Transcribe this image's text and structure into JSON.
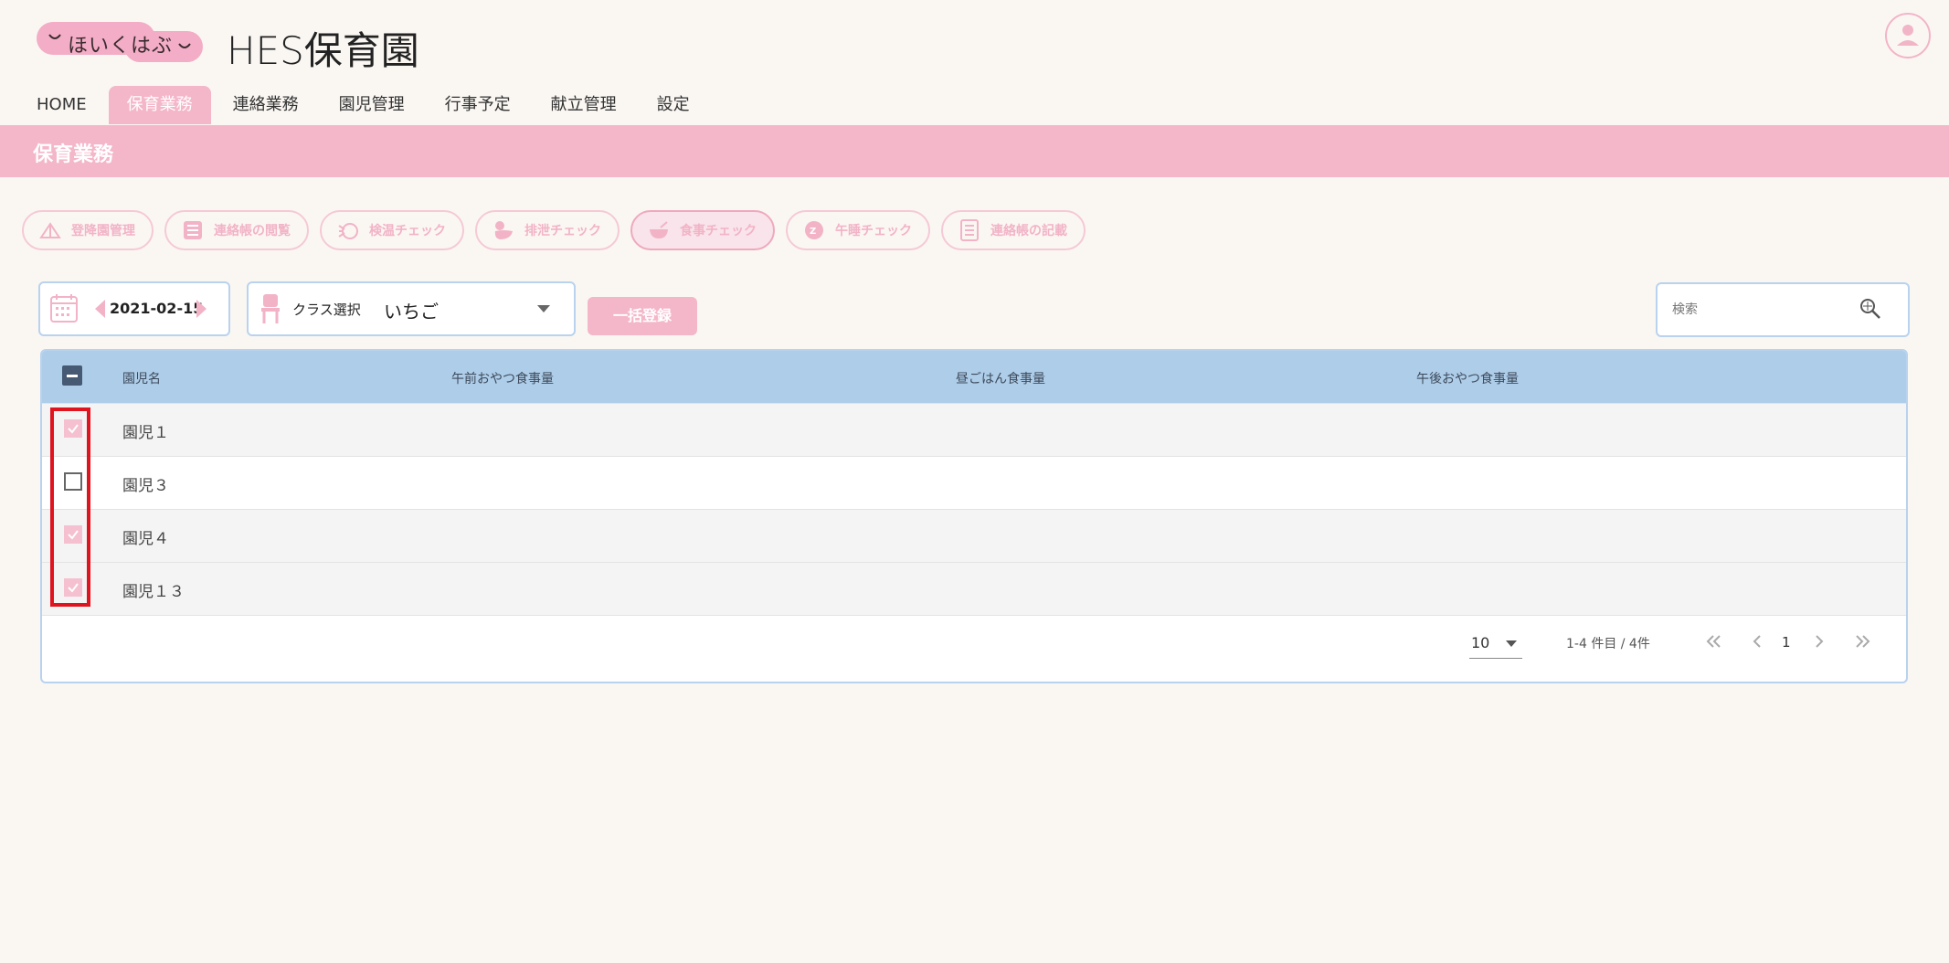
{
  "header": {
    "logo_text": "ほいくはぶ",
    "app_title": "HES保育園"
  },
  "nav": {
    "tabs": [
      {
        "label": "HOME",
        "active": false
      },
      {
        "label": "保育業務",
        "active": true
      },
      {
        "label": "連絡業務",
        "active": false
      },
      {
        "label": "園児管理",
        "active": false
      },
      {
        "label": "行事予定",
        "active": false
      },
      {
        "label": "献立管理",
        "active": false
      },
      {
        "label": "設定",
        "active": false
      }
    ]
  },
  "section": {
    "title": "保育業務"
  },
  "functions": [
    {
      "label": "登降園管理",
      "icon": "tent-icon",
      "active": false
    },
    {
      "label": "連絡帳の閲覧",
      "icon": "list-icon",
      "active": false
    },
    {
      "label": "検温チェック",
      "icon": "thermometer-icon",
      "active": false
    },
    {
      "label": "排泄チェック",
      "icon": "duck-icon",
      "active": false
    },
    {
      "label": "食事チェック",
      "icon": "bowl-icon",
      "active": true
    },
    {
      "label": "午睡チェック",
      "icon": "sleep-icon",
      "active": false
    },
    {
      "label": "連絡帳の記載",
      "icon": "notebook-icon",
      "active": false
    }
  ],
  "toolbar": {
    "date": "2021-02-15",
    "class_label": "クラス選択",
    "class_value": "いちご",
    "bulk_register_label": "一括登録",
    "search_placeholder": "検索"
  },
  "table": {
    "headers": [
      "園児名",
      "午前おやつ食事量",
      "昼ごはん食事量",
      "午後おやつ食事量"
    ],
    "rows": [
      {
        "name": "園児１",
        "checked": true
      },
      {
        "name": "園児３",
        "checked": false
      },
      {
        "name": "園児４",
        "checked": true
      },
      {
        "name": "園児１３",
        "checked": true
      }
    ]
  },
  "pagination": {
    "page_size": "10",
    "range_text": "1-4 件目 / 4件",
    "current_page": "1"
  },
  "colors": {
    "accent_pink": "#f4b6c9",
    "header_blue": "#aecde9",
    "border_blue": "#b9d2ee",
    "highlight_red": "#e0141f"
  }
}
